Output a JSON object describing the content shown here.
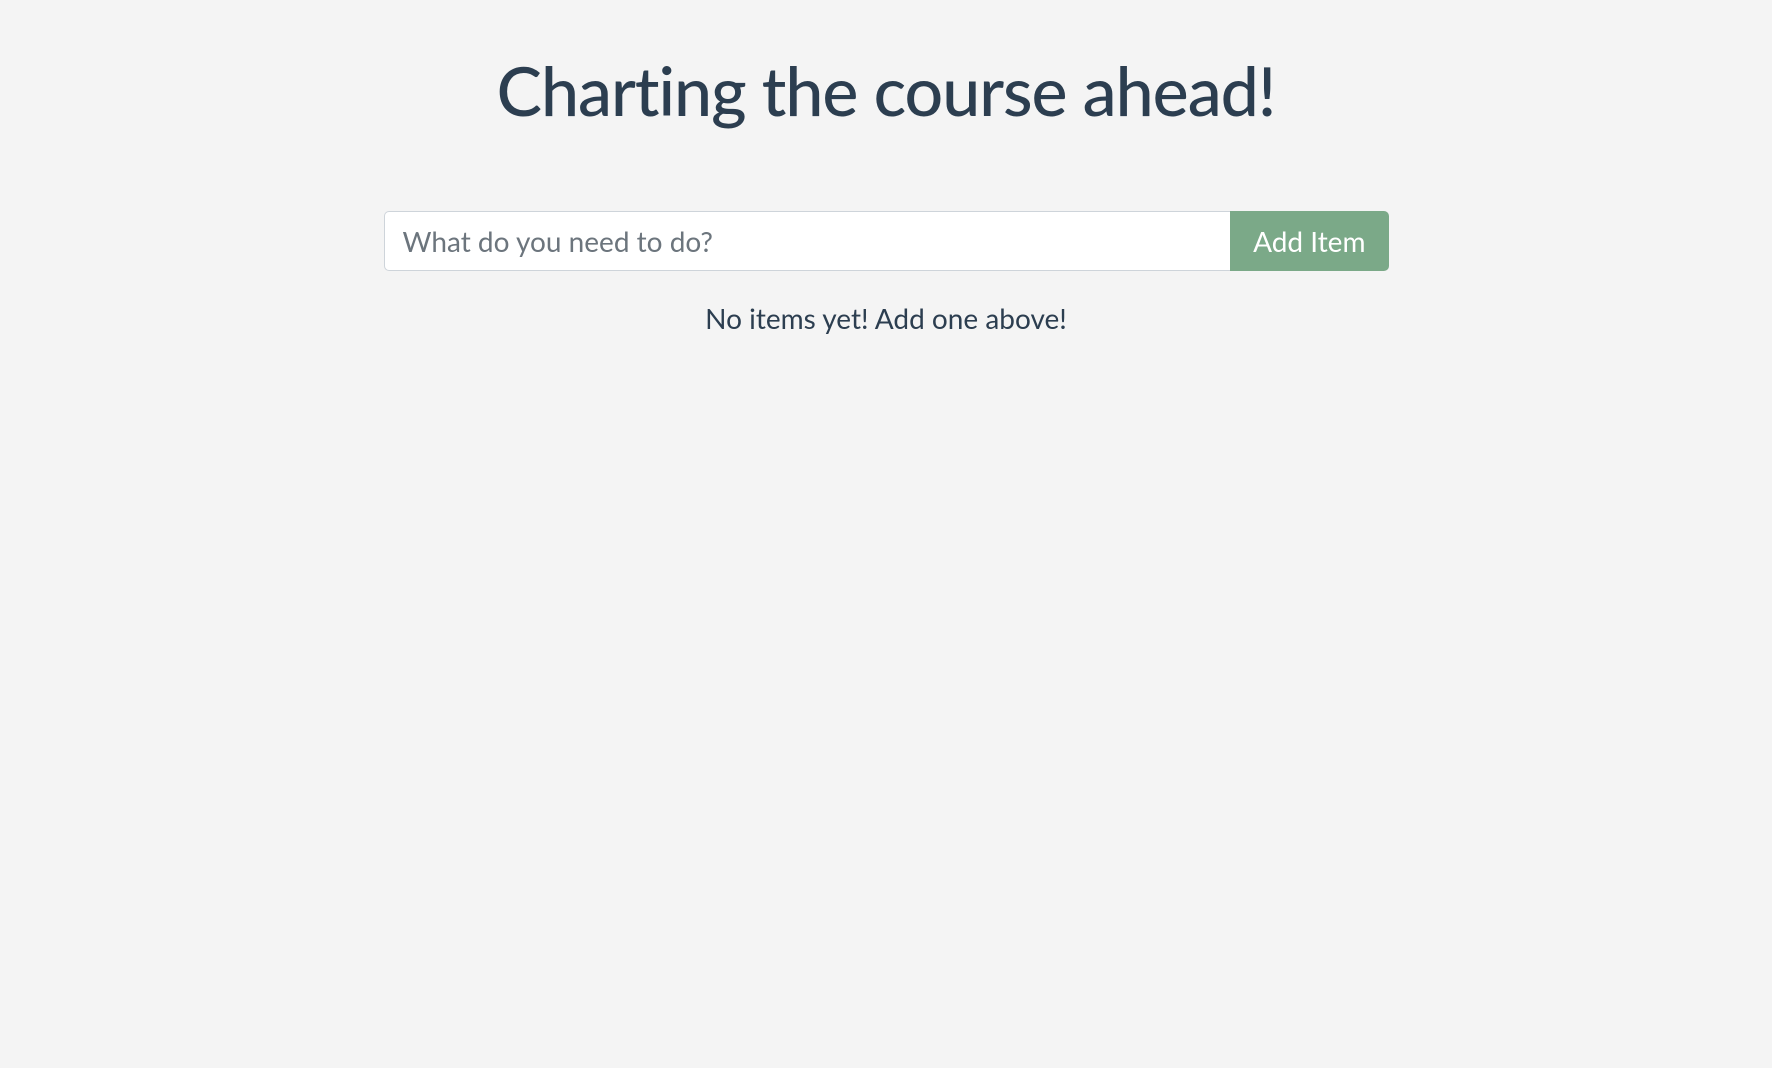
{
  "header": {
    "title": "Charting the course ahead!"
  },
  "form": {
    "input_placeholder": "What do you need to do?",
    "input_value": "",
    "add_button_label": "Add Item"
  },
  "list": {
    "empty_message": "No items yet! Add one above!"
  },
  "colors": {
    "background": "#f4f4f4",
    "text": "#2c3e50",
    "button_bg": "#7ba988",
    "button_text": "#ffffff",
    "input_border": "#ced4da"
  }
}
